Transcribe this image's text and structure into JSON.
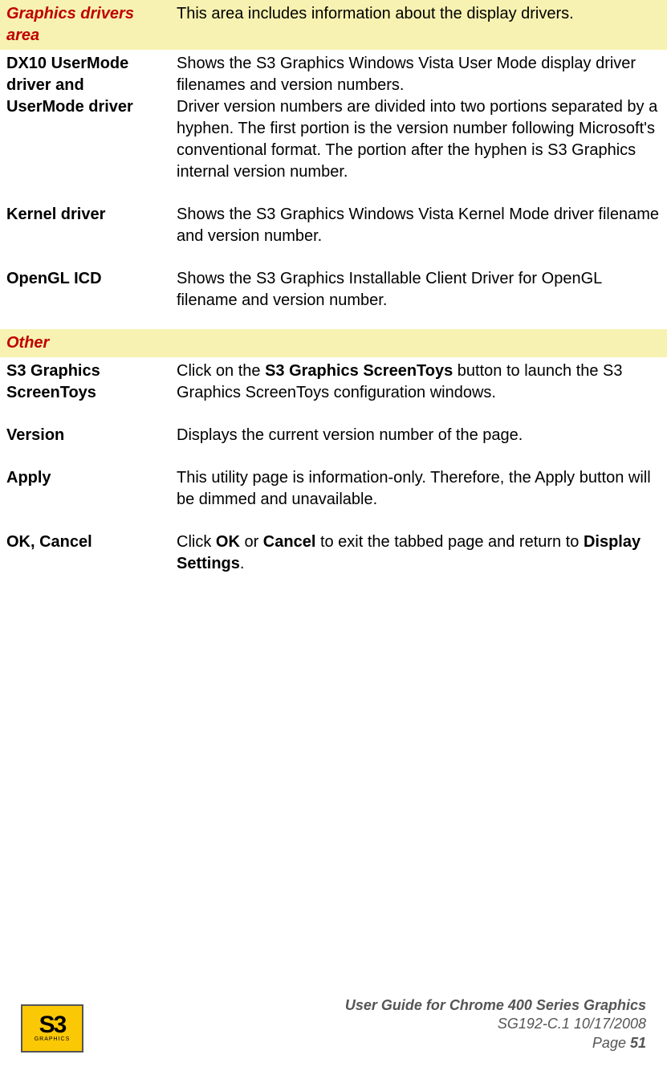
{
  "sections": {
    "graphics_drivers": {
      "header_label": "Graphics drivers area",
      "header_desc": "This area includes information about the display drivers.",
      "rows": {
        "dx10": {
          "label": "DX10 UserMode driver and UserMode driver",
          "desc": "Shows the S3 Graphics Windows Vista User Mode display driver filenames and version numbers.\nDriver version numbers are divided into two portions separated by a hyphen. The first portion is the version number following Microsoft's conventional format. The portion after the hyphen is S3 Graphics internal version number."
        },
        "kernel": {
          "label": "Kernel driver",
          "desc": "Shows the S3 Graphics Windows Vista Kernel Mode driver filename and version number."
        },
        "opengl": {
          "label": "OpenGL ICD",
          "desc": "Shows the S3 Graphics Installable Client Driver for OpenGL filename and version number."
        }
      }
    },
    "other": {
      "header_label": "Other",
      "rows": {
        "screentoys": {
          "label": "S3 Graphics ScreenToys",
          "desc_pre": "Click on the ",
          "desc_bold": "S3 Graphics ScreenToys",
          "desc_post": " button to launch the S3 Graphics ScreenToys configuration windows."
        },
        "version": {
          "label": "Version",
          "desc": "Displays the current version number of the page."
        },
        "apply": {
          "label": "Apply",
          "desc": "This utility page is information-only. Therefore, the Apply button will be dimmed and unavailable."
        },
        "okcancel": {
          "label": "OK, Cancel",
          "desc_pre": "Click ",
          "desc_b1": "OK",
          "desc_mid": " or ",
          "desc_b2": "Cancel",
          "desc_mid2": " to exit the tabbed page and return to ",
          "desc_b3": "Display Settings",
          "desc_post": "."
        }
      }
    }
  },
  "footer": {
    "title": "User Guide for Chrome 400 Series Graphics",
    "doc_ref": "SG192-C.1   10/17/2008",
    "page_label": "Page ",
    "page_num": "51",
    "logo_main": "S3",
    "logo_sub": "GRAPHICS"
  }
}
